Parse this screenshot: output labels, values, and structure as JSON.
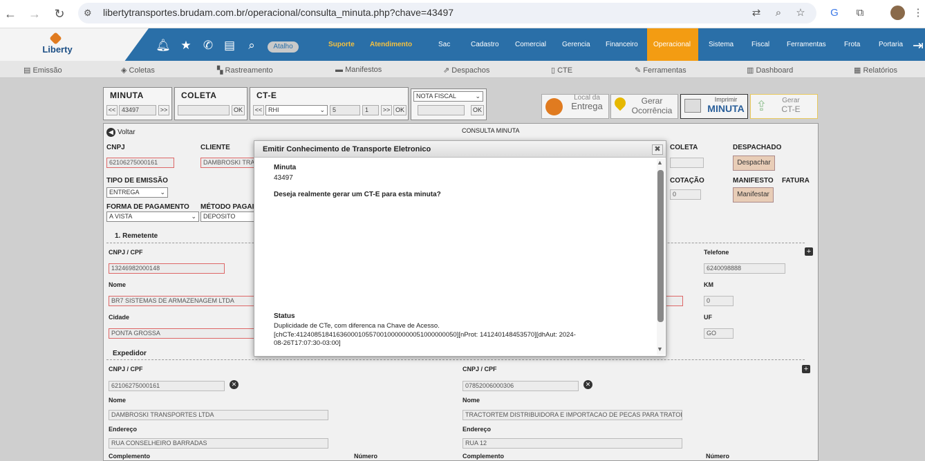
{
  "browser": {
    "url": "libertytransportes.brudam.com.br/operacional/consulta_minuta.php?chave=43497"
  },
  "app": {
    "logo_text": "Liberty",
    "atalho": "Atalho",
    "links_highlight": [
      "Suporte",
      "Atendimento"
    ],
    "menu": [
      "Sac",
      "Cadastro",
      "Comercial",
      "Gerencia",
      "Financeiro",
      "Operacional",
      "Sistema",
      "Fiscal",
      "Ferramentas",
      "Frota",
      "Portaria"
    ],
    "active_menu": "Operacional",
    "subnav": [
      "Emissão",
      "Coletas",
      "Rastreamento",
      "Manifestos",
      "Despachos",
      "CTE",
      "Ferramentas",
      "Dashboard",
      "Relatórios"
    ]
  },
  "top_panels": {
    "minuta": {
      "title": "MINUTA",
      "prev": "<<",
      "value": "43497",
      "next": ">>"
    },
    "coleta": {
      "title": "COLETA",
      "ok": "OK"
    },
    "cte": {
      "title": "CT-E",
      "prev": "<<",
      "select": "RHI",
      "num1": "5",
      "num2": "1",
      "next": ">>",
      "ok": "OK"
    },
    "nota": {
      "select": "NOTA FISCAL",
      "ok": "OK"
    }
  },
  "action_buttons": {
    "local": {
      "line1": "Local da",
      "line2": "Entrega"
    },
    "ocorrencia": {
      "line1": "Gerar",
      "line2": "Ocorrência"
    },
    "imprimir": {
      "line1": "Imprimir",
      "line2": "MINUTA"
    },
    "gerar_cte": {
      "line1": "Gerar",
      "line2": "CT-E"
    }
  },
  "main": {
    "voltar": "Voltar",
    "heading": "CONSULTA MINUTA",
    "cnpj_label": "CNPJ",
    "cnpj_value": "62106275000161",
    "cliente_label": "CLIENTE",
    "cliente_value": "DAMBROSKI TRA",
    "tipo_emissao_label": "TIPO DE EMISSÃO",
    "tipo_emissao_value": "ENTREGA",
    "forma_pag_label": "FORMA DE PAGAMENTO",
    "forma_pag_value": "A VISTA",
    "metodo_label": "MÉTODO PAGAI",
    "metodo_value": "DEPOSITO",
    "coleta_label": "COLETA",
    "despachado_label": "DESPACHADO",
    "despachar_btn": "Despachar",
    "cotacao_label": "COTAÇÃO",
    "cotacao_value": "0",
    "manifesto_label": "MANIFESTO",
    "fatura_label": "FATURA",
    "manifestar_btn": "Manifestar",
    "remetente_title": "1. Remetente",
    "rem_cnpj_label": "CNPJ / CPF",
    "rem_cnpj_value": "13246982000148",
    "rem_nome_label": "Nome",
    "rem_nome_value": "BR7 SISTEMAS DE ARMAZENAGEM LTDA",
    "rem_cidade_label": "Cidade",
    "rem_cidade_value": "PONTA GROSSA",
    "telefone_label": "Telefone",
    "telefone_value": "6240098888",
    "km_label": "KM",
    "km_value": "0",
    "uf_label": "UF",
    "uf_value": "GO",
    "expedidor_title": "Expedidor",
    "exp_cnpj_label": "CNPJ / CPF",
    "exp_cnpj_value": "62106275000161",
    "exp_nome_label": "Nome",
    "exp_nome_value": "DAMBROSKI TRANSPORTES LTDA",
    "exp_end_label": "Endereço",
    "exp_end_value": "RUA CONSELHEIRO BARRADAS",
    "exp_comp_label": "Complemento",
    "exp_num_label": "Número",
    "rec_cnpj_label": "CNPJ / CPF",
    "rec_cnpj_value": "07852006000306",
    "rec_nome_label": "Nome",
    "rec_nome_value": "TRACTORTEM DISTRIBUIDORA E IMPORTACAO DE PECAS PARA TRATOI",
    "rec_end_label": "Endereço",
    "rec_end_value": "RUA 12",
    "rec_comp_label": "Complemento",
    "rec_num_label": "Número"
  },
  "modal": {
    "title": "Emitir Conhecimento de Transporte Eletronico",
    "minuta_label": "Minuta",
    "minuta_value": "43497",
    "question": "Deseja realmente gerar um CT-E para esta minuta?",
    "status_label": "Status",
    "status_line1": "Duplicidade de CTe, com diferenca na Chave de Acesso.",
    "status_line2": "[chCTe:41240851841636000105570010000000051000000050][nProt: 141240148453570][dhAut: 2024-",
    "status_line3": "08-26T17:07:30-03:00]"
  }
}
